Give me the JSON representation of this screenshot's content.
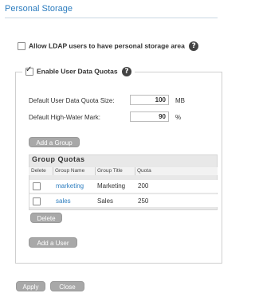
{
  "page": {
    "title": "Personal Storage"
  },
  "ldap": {
    "label": "Allow LDAP users to have personal storage area",
    "checked": false
  },
  "quotas": {
    "legend": "Enable User Data Quotas",
    "checked": true,
    "fields": [
      {
        "label": "Default User Data Quota Size:",
        "value": "100",
        "unit": "MB"
      },
      {
        "label": "Default High-Water Mark:",
        "value": "90",
        "unit": "%"
      }
    ],
    "add_group_label": "Add a Group",
    "group_quotas": {
      "title": "Group Quotas",
      "columns": [
        "Delete",
        "Group Name",
        "Group Title",
        "Quota"
      ],
      "rows": [
        {
          "name": "marketing",
          "title": "Marketing",
          "quota": "200"
        },
        {
          "name": "sales",
          "title": "Sales",
          "quota": "250"
        }
      ],
      "delete_label": "Delete"
    },
    "add_user_label": "Add a User"
  },
  "footer": {
    "apply_label": "Apply",
    "close_label": "Close"
  },
  "colors": {
    "accent": "#2d7dbf",
    "button": "#a8a8a8",
    "panel": "#e8e8e8"
  }
}
